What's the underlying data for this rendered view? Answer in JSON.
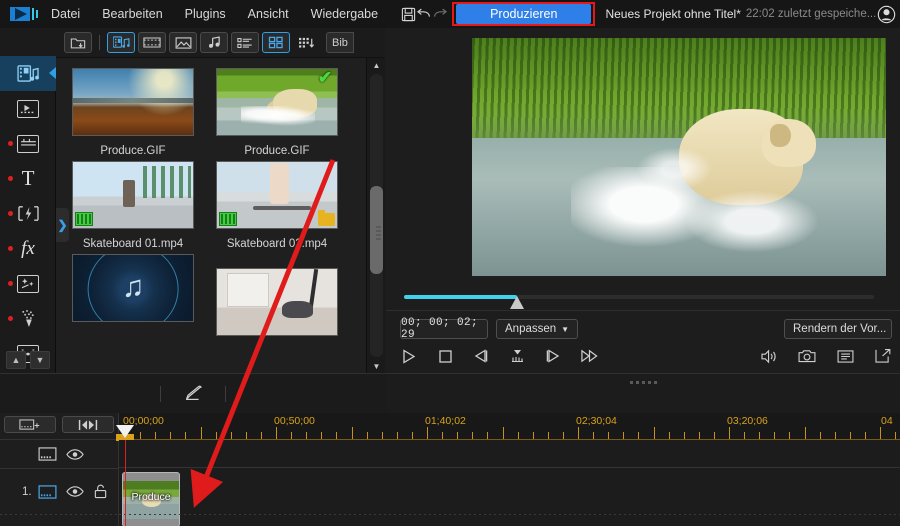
{
  "menubar": {
    "logo_icon": "video-editor-logo-icon",
    "items": [
      "Datei",
      "Bearbeiten",
      "Plugins",
      "Ansicht",
      "Wiedergabe"
    ],
    "save_icon": "save-icon",
    "undo_icon": "undo-arrow-icon",
    "redo_icon": "redo-arrow-icon",
    "produce_label": "Produzieren",
    "produce_highlight_color": "#e81818",
    "produce_bg_color": "#2f7fe8",
    "project_title": "Neues Projekt ohne Titel*",
    "last_saved": "22:02 zuletzt gespeiche...",
    "account_icon": "account-circle-icon",
    "notification_icon": "bell-icon",
    "settings_icon": "gear-icon"
  },
  "left_rail": {
    "items": [
      {
        "name": "media-library",
        "icon": "media-library-icon",
        "active": true,
        "badge": false
      },
      {
        "name": "video-clips",
        "icon": "film-strip-icon",
        "active": false,
        "badge": false
      },
      {
        "name": "backgrounds",
        "icon": "clapperboard-icon",
        "active": false,
        "badge": true
      },
      {
        "name": "titles",
        "icon": "text-T-icon",
        "active": false,
        "badge": true
      },
      {
        "name": "transitions",
        "icon": "transition-icon",
        "active": false,
        "badge": true
      },
      {
        "name": "effects",
        "icon": "fx-icon",
        "active": false,
        "badge": true
      },
      {
        "name": "overlays",
        "icon": "sparkle-frame-icon",
        "active": false,
        "badge": true
      },
      {
        "name": "particles",
        "icon": "particle-icon",
        "active": false,
        "badge": true
      },
      {
        "name": "subtitles",
        "icon": "subtitle-icon",
        "active": false,
        "badge": false
      }
    ],
    "scroll_up_icon": "chevron-up-icon",
    "scroll_down_icon": "chevron-down-icon"
  },
  "media_panel": {
    "toolbar": {
      "import_icon": "import-folder-icon",
      "filters": [
        {
          "name": "all-media",
          "icon": "media-mixed-icon",
          "selected": true
        },
        {
          "name": "video",
          "icon": "film-icon",
          "selected": false
        },
        {
          "name": "image",
          "icon": "image-icon",
          "selected": false
        },
        {
          "name": "audio",
          "icon": "music-note-icon",
          "selected": false
        }
      ],
      "views": [
        {
          "name": "list-view",
          "icon": "list-view-icon",
          "selected": false
        },
        {
          "name": "grid-view",
          "icon": "grid-view-icon",
          "selected": true
        }
      ],
      "sort_icon": "sort-grid-icon",
      "tab_label": "Bib"
    },
    "expand_handle_icon": "chevron-right-icon",
    "scrollbar": {
      "up_icon": "triangle-up-icon",
      "down_icon": "triangle-down-icon"
    },
    "items": [
      {
        "label": "Produce.GIF",
        "art": "art-canyon",
        "checked": false,
        "film_badge": false,
        "folder_badge": false
      },
      {
        "label": "Produce.GIF",
        "art": "art-dog",
        "checked": true,
        "film_badge": false,
        "folder_badge": false
      },
      {
        "label": "Skateboard 01.mp4",
        "art": "art-skate1",
        "checked": false,
        "film_badge": true,
        "folder_badge": false
      },
      {
        "label": "Skateboard 02.mp4",
        "art": "art-skate2",
        "checked": false,
        "film_badge": true,
        "folder_badge": true
      },
      {
        "label": "",
        "art": "art-music",
        "checked": false,
        "film_badge": false,
        "folder_badge": false
      },
      {
        "label": "",
        "art": "art-gym",
        "checked": false,
        "film_badge": false,
        "folder_badge": false
      }
    ]
  },
  "preview": {
    "scrub_position_percent": 24,
    "timecode": "00; 00; 02; 29",
    "fit_label": "Anpassen",
    "fit_caret_icon": "caret-down-icon",
    "render_label": "Rendern der Vor...",
    "transport": [
      {
        "name": "play-button",
        "icon": "play-icon"
      },
      {
        "name": "stop-button",
        "icon": "stop-icon"
      },
      {
        "name": "previous-frame-button",
        "icon": "step-back-icon"
      },
      {
        "name": "set-marker-button",
        "icon": "marker-icon"
      },
      {
        "name": "next-frame-button",
        "icon": "step-forward-icon"
      },
      {
        "name": "fast-forward-button",
        "icon": "fast-forward-icon"
      }
    ],
    "right_icons": [
      {
        "name": "volume-button",
        "icon": "speaker-icon"
      },
      {
        "name": "snapshot-button",
        "icon": "camera-icon"
      },
      {
        "name": "playlist-button",
        "icon": "list-icon"
      },
      {
        "name": "popout-button",
        "icon": "external-link-icon"
      }
    ]
  },
  "timeline": {
    "tool_icon": "pen-tool-icon",
    "buttons": [
      {
        "name": "add-track-button",
        "icon": "add-track-icon"
      },
      {
        "name": "ripple-edit-button",
        "icon": "ripple-edit-icon"
      }
    ],
    "ruler_labels": [
      "00;00;00",
      "00;50;00",
      "01;40;02",
      "02;30;04",
      "03;20;06",
      "04"
    ],
    "ruler_label_color": "#d9a21a",
    "playhead_icon": "playhead-marker-icon",
    "playhead_line_color": "#e02020",
    "master_track": {
      "name": "master-track",
      "track_icon": "master-track-icon",
      "eye_icon": "eye-icon"
    },
    "tracks": [
      {
        "number": "1.",
        "track_icon": "video-track-icon",
        "eye_icon": "eye-icon",
        "lock_icon": "unlock-icon",
        "clips": [
          {
            "label": "Produce"
          }
        ]
      }
    ]
  },
  "annotation": {
    "arrow_color": "#e01b1b",
    "description": "red-arrow-from-media-to-timeline"
  }
}
